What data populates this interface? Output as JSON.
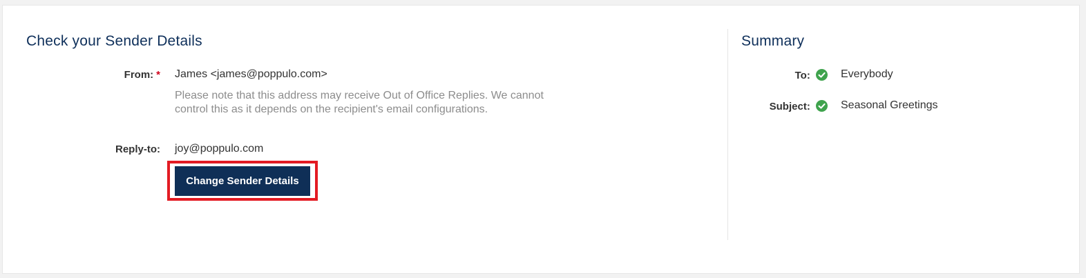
{
  "sender": {
    "title": "Check your Sender Details",
    "from_label": "From:",
    "required_marker": "*",
    "from_value": "James <james@poppulo.com>",
    "note": "Please note that this address may receive Out of Office Replies. We cannot control this as it depends on the recipient's email configurations.",
    "reply_to_label": "Reply-to:",
    "reply_to_value": "joy@poppulo.com",
    "change_button_label": "Change Sender Details"
  },
  "summary": {
    "title": "Summary",
    "items": [
      {
        "label": "To:",
        "value": "Everybody",
        "status_icon": "check-circle-icon"
      },
      {
        "label": "Subject:",
        "value": "Seasonal Greetings",
        "status_icon": "check-circle-icon"
      }
    ]
  },
  "colors": {
    "accent_navy": "#0f2f57",
    "title_blue": "#0e2f5a",
    "highlight_red": "#e31b23",
    "success_green": "#3fa34d",
    "required_red": "#d0021b",
    "note_gray": "#8c8c8c"
  }
}
